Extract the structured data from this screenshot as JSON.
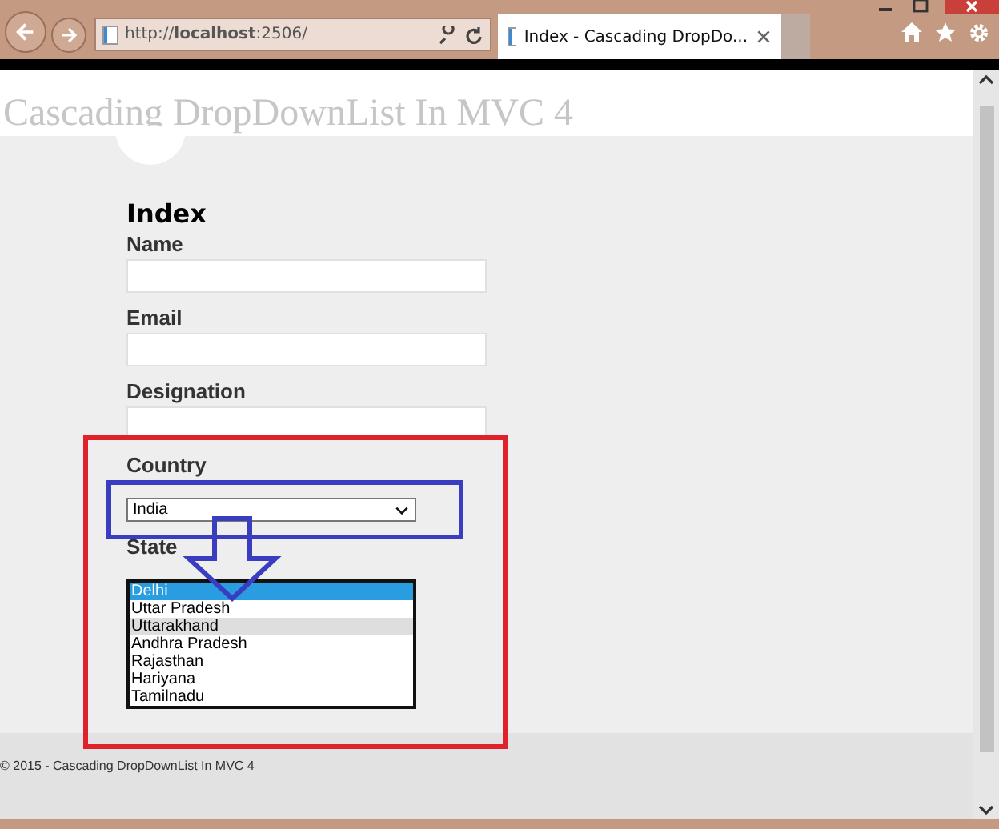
{
  "browser": {
    "address": "http://**localhost**:2506/",
    "tab_title": "Index - Cascading DropDo..."
  },
  "site_title": "Cascading DropDownList In MVC 4",
  "heading": "Index",
  "fields": [
    {
      "kind": "text",
      "label": "Name"
    },
    {
      "kind": "text",
      "label": "Email"
    },
    {
      "kind": "text",
      "label": "Designation"
    },
    {
      "kind": "select",
      "label": "Country",
      "value": "India"
    },
    {
      "kind": "listbox",
      "label": "State",
      "options": [
        {
          "text": "Delhi",
          "selected": true,
          "hovered": false
        },
        {
          "text": "Uttar Pradesh",
          "selected": false,
          "hovered": false
        },
        {
          "text": "Uttarakhand",
          "selected": false,
          "hovered": true
        },
        {
          "text": "Andhra Pradesh",
          "selected": false,
          "hovered": false
        },
        {
          "text": "Rajasthan",
          "selected": false,
          "hovered": false
        },
        {
          "text": "Hariyana",
          "selected": false,
          "hovered": false
        },
        {
          "text": "Tamilnadu",
          "selected": false,
          "hovered": false
        }
      ]
    }
  ],
  "footer": "© 2015 - Cascading DropDownList In MVC 4"
}
